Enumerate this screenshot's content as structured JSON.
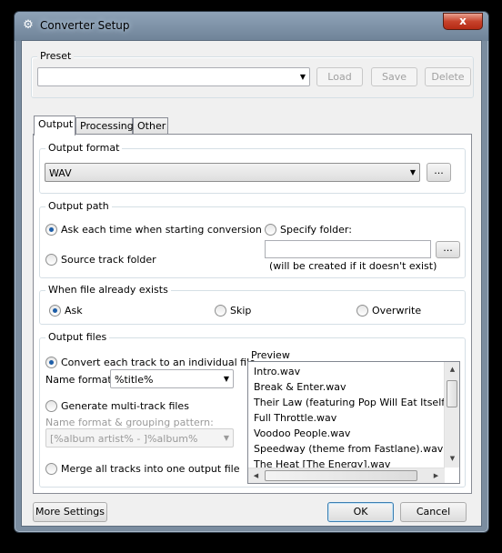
{
  "window": {
    "title": "Converter Setup",
    "close_label": "x"
  },
  "preset": {
    "group_label": "Preset",
    "value": "",
    "load_label": "Load",
    "save_label": "Save",
    "delete_label": "Delete"
  },
  "tabs": [
    {
      "label": "Output",
      "active": true
    },
    {
      "label": "Processing",
      "active": false
    },
    {
      "label": "Other",
      "active": false
    }
  ],
  "output_format": {
    "group_label": "Output format",
    "value": "WAV",
    "browse_label": "..."
  },
  "output_path": {
    "group_label": "Output path",
    "ask_label": "Ask each time when starting conversion",
    "source_label": "Source track folder",
    "specify_label": "Specify folder:",
    "folder_value": "",
    "browse_label": "...",
    "note": "(will be created if it doesn't exist)",
    "selected": "ask"
  },
  "file_exists": {
    "group_label": "When file already exists",
    "ask_label": "Ask",
    "skip_label": "Skip",
    "overwrite_label": "Overwrite",
    "selected": "ask"
  },
  "output_files": {
    "group_label": "Output files",
    "individual_label": "Convert each track to an individual file",
    "name_format_label": "Name format:",
    "name_format_value": "%title%",
    "multi_label": "Generate multi-track files",
    "grouping_label": "Name format & grouping pattern:",
    "grouping_value": "[%album artist% - ]%album%",
    "merge_label": "Merge all tracks into one output file",
    "selected": "individual",
    "preview_label": "Preview",
    "preview_items": [
      "Intro.wav",
      "Break & Enter.wav",
      "Their Law (featuring Pop Will Eat Itself).wav",
      "Full Throttle.wav",
      "Voodoo People.wav",
      "Speedway (theme from Fastlane).wav",
      "The Heat [The Energy].wav"
    ]
  },
  "footer": {
    "more_settings_label": "More Settings",
    "ok_label": "OK",
    "cancel_label": "Cancel"
  },
  "colors": {
    "selection": "#1d5ea8",
    "frame": "#7b8da0"
  },
  "icons": {
    "title": "gear-icon",
    "close": "close-icon"
  }
}
